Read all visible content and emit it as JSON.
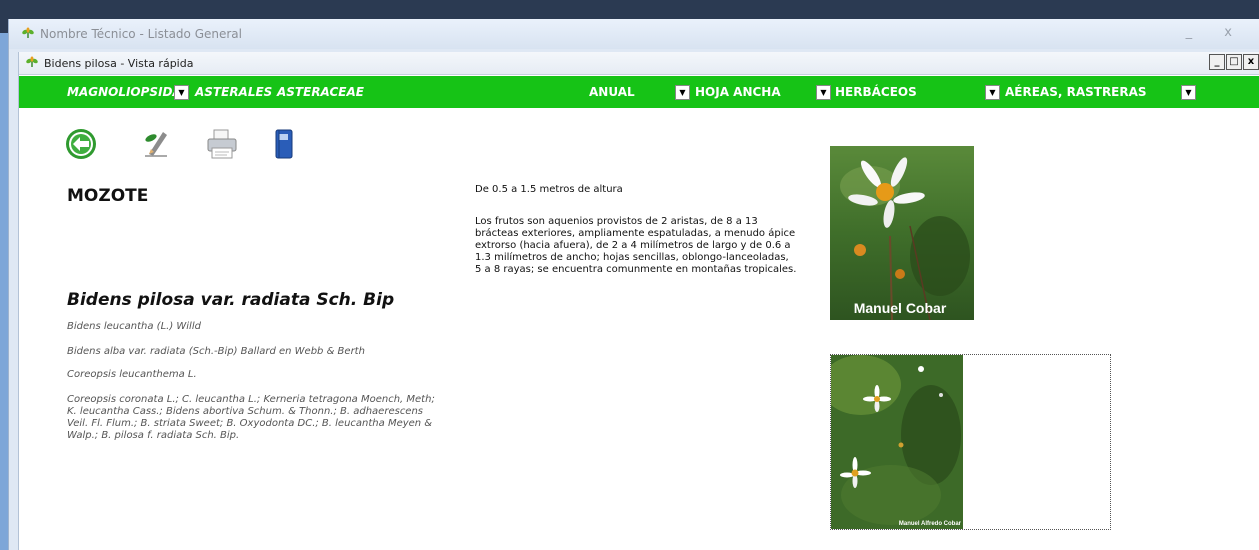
{
  "outer_window": {
    "title": "Nombre Técnico - Listado General",
    "controls": "_ x"
  },
  "inner_window": {
    "title": "Bidens pilosa - Vista rápida",
    "min": "_",
    "max": "□",
    "close": "x"
  },
  "taxonomy_bar": {
    "class": "MAGNOLIOPSIDA",
    "order": "ASTERALES",
    "family": "ASTERACEAE",
    "cycle": "ANUAL",
    "leaf": "HOJA ANCHA",
    "habit": "HERBÁCEOS",
    "parts": "AÉREAS, RASTRERAS"
  },
  "toolbar": {
    "icons": [
      "back-arrow-icon",
      "edit-icon",
      "print-icon",
      "book-icon"
    ]
  },
  "plant": {
    "common_name": "MOZOTE",
    "scientific_name": "Bidens pilosa var. radiata Sch. Bip",
    "synonyms": [
      "Bidens leucantha (L.) Willd",
      "Bidens alba var. radiata (Sch.-Bip) Ballard en Webb & Berth",
      "Coreopsis leucanthema L.",
      "Coreopsis coronata L.; C. leucantha L.; Kerneria tetragona Moench, Meth; K. leucantha Cass.; Bidens abortiva Schum. & Thonn.; B. adhaerescens Veil. Fl. Flum.; B. striata Sweet; B. Oxyodonta DC.; B. leucantha Meyen & Walp.; B. pilosa f. radiata Sch. Bip."
    ],
    "height": "De 0.5 a 1.5 metros de altura",
    "description": "Los frutos son aquenios provistos de 2 aristas, de 8 a 13 brácteas exteriores, ampliamente espatuladas, a menudo ápice extrorso (hacia afuera), de 2 a 4 milímetros de largo y de 0.6 a 1.3 milímetros de ancho; hojas sencillas, oblongo-lanceoladas, 5 a 8 rayas; se encuentra comunmente en montañas tropicales."
  },
  "photos": {
    "photo1_credit": "Manuel Cobar",
    "photo2_credit": "Manuel Alfredo Cobar"
  },
  "colors": {
    "green_bar": "#16c316"
  }
}
